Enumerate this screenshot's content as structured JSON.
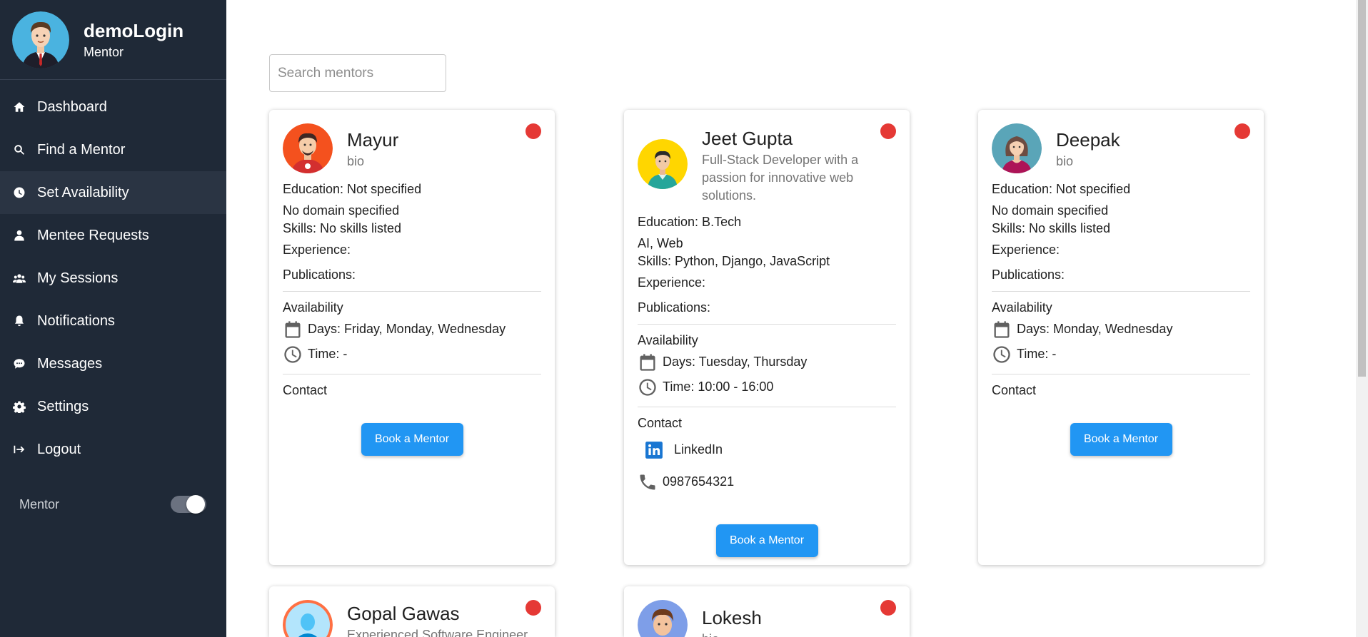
{
  "user": {
    "name": "demoLogin",
    "role": "Mentor"
  },
  "nav": [
    {
      "label": "Dashboard",
      "icon": "home-icon"
    },
    {
      "label": "Find a Mentor",
      "icon": "search-icon"
    },
    {
      "label": "Set Availability",
      "icon": "clock-icon",
      "active": true
    },
    {
      "label": "Mentee Requests",
      "icon": "person-icon"
    },
    {
      "label": "My Sessions",
      "icon": "group-icon"
    },
    {
      "label": "Notifications",
      "icon": "bell-icon"
    },
    {
      "label": "Messages",
      "icon": "chat-icon"
    },
    {
      "label": "Settings",
      "icon": "gear-icon"
    },
    {
      "label": "Logout",
      "icon": "logout-icon"
    }
  ],
  "mode": {
    "label": "Mentor",
    "on": true
  },
  "search": {
    "placeholder": "Search mentors"
  },
  "status_color": "#e53935",
  "accent_color": "#2196f3",
  "mentors": [
    {
      "name": "Mayur",
      "bio": "bio",
      "education": "Education: Not specified",
      "domain": "No domain specified",
      "skills": "Skills: No skills listed",
      "experience": "Experience:",
      "publications": "Publications:",
      "availability_label": "Availability",
      "days": "Days: Friday, Monday, Wednesday",
      "time": "Time: -",
      "contact_label": "Contact",
      "book_label": "Book a Mentor"
    },
    {
      "name": "Jeet Gupta",
      "bio": "Full-Stack Developer with a passion for innovative web solutions.",
      "education": "Education: B.Tech",
      "domain": "AI, Web",
      "skills": "Skills: Python, Django, JavaScript",
      "experience": "Experience:",
      "publications": "Publications:",
      "availability_label": "Availability",
      "days": "Days: Tuesday, Thursday",
      "time": "Time: 10:00 - 16:00",
      "contact_label": "Contact",
      "linkedin": "LinkedIn",
      "phone": "0987654321",
      "book_label": "Book a Mentor"
    },
    {
      "name": "Deepak",
      "bio": "bio",
      "education": "Education: Not specified",
      "domain": "No domain specified",
      "skills": "Skills: No skills listed",
      "experience": "Experience:",
      "publications": "Publications:",
      "availability_label": "Availability",
      "days": "Days: Monday, Wednesday",
      "time": "Time: -",
      "contact_label": "Contact",
      "book_label": "Book a Mentor"
    },
    {
      "name": "Gopal Gawas",
      "bio": "Experienced Software Engineer"
    },
    {
      "name": "Lokesh",
      "bio": "bio"
    }
  ]
}
